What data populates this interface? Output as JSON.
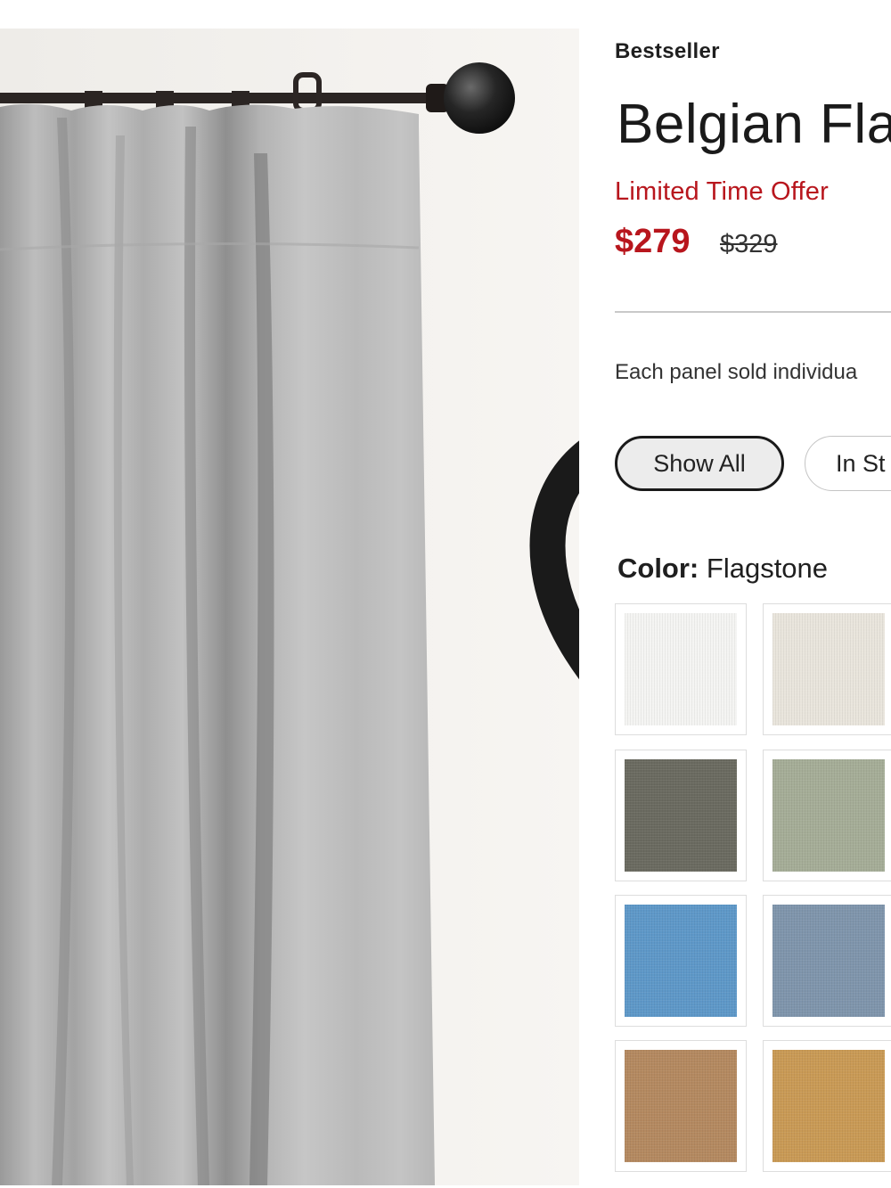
{
  "product": {
    "badge": "Bestseller",
    "title": "Belgian Fla",
    "promo": "Limited Time Offer",
    "sale_price": "$279",
    "original_price": "$329",
    "panel_note": "Each panel sold individua"
  },
  "filters": {
    "show_all": "Show All",
    "in_stock": "In St"
  },
  "color": {
    "label": "Color:",
    "selected": "Flagstone"
  },
  "swatches": [
    {
      "color": "#f4f4f2"
    },
    {
      "color": "#e9e5dc"
    },
    {
      "color": "#6a6a60"
    },
    {
      "color": "#a5ad97"
    },
    {
      "color": "#5e98c8"
    },
    {
      "color": "#7f95ac"
    },
    {
      "color": "#b48960"
    },
    {
      "color": "#c99a55"
    }
  ],
  "icons": {
    "wishlist": "heart-outline-icon"
  },
  "colors": {
    "accent_red": "#b8161d",
    "text": "#1a1a1a"
  }
}
